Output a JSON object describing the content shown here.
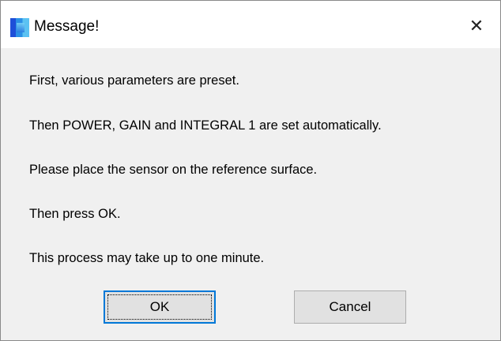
{
  "window": {
    "title": "Message!",
    "close_symbol": "✕",
    "icon": "app-icon"
  },
  "message": {
    "lines": [
      "First, various parameters are preset.",
      "Then POWER, GAIN and INTEGRAL 1 are set automatically.",
      "Please place the sensor on the reference surface.",
      "Then press OK.",
      "This process may take up to one minute."
    ]
  },
  "buttons": {
    "ok_label": "OK",
    "cancel_label": "Cancel"
  },
  "colors": {
    "focus_border": "#0078d7",
    "button_face": "#e1e1e1",
    "dialog_background": "#f0f0f0"
  }
}
